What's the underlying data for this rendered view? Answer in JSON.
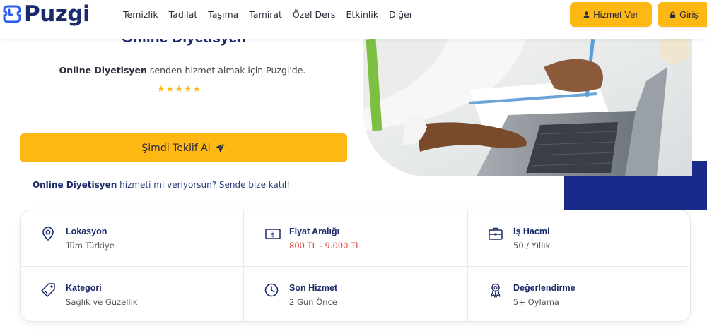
{
  "brand": {
    "name": "Puzgi",
    "color": "#1b2a6b"
  },
  "nav": [
    "Temizlik",
    "Tadilat",
    "Taşıma",
    "Tamirat",
    "Özel Ders",
    "Etkinlik",
    "Diğer"
  ],
  "header_buttons": {
    "provider": "Hizmet Ver",
    "login": "Giriş"
  },
  "hero": {
    "title": "Online Diyetisyen",
    "subtitle_strong": "Online Diyetisyen",
    "subtitle_rest": " senden hizmet almak için Puzgi'de.",
    "rating_stars": 5,
    "cta_label": "Şimdi Teklif Al",
    "join_strong": "Online Diyetisyen",
    "join_rest": " hizmeti mi veriyorsun? Sende bize katıl!"
  },
  "info": [
    {
      "label": "Lokasyon",
      "value": "Tüm Türkiye",
      "icon": "location-pin-icon"
    },
    {
      "label": "Fiyat Aralığı",
      "value": "800 TL - 9.000 TL",
      "icon": "money-icon",
      "highlight": true
    },
    {
      "label": "İş Hacmi",
      "value": "50 / Yıllık",
      "icon": "briefcase-icon"
    },
    {
      "label": "Kategori",
      "value": "Sağlık ve Güzellik",
      "icon": "tag-icon"
    },
    {
      "label": "Son Hizmet",
      "value": "2 Gün Önce",
      "icon": "clock-icon"
    },
    {
      "label": "Değerlendirme",
      "value": "5+ Oylama",
      "icon": "award-icon"
    }
  ],
  "colors": {
    "accent": "#fdb813",
    "navy": "#1a2a8a",
    "price": "#e0453a"
  }
}
